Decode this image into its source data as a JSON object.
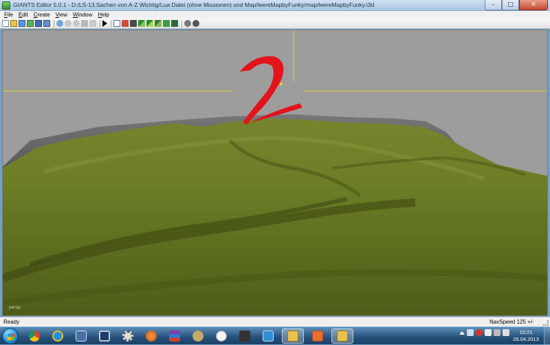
{
  "window": {
    "title": "GIANTS Editor 5.0.1 - D:/LS-13.Sachen von A-Z Wichtig/Lua Datei (ohne Missionen) und Map/leereMapbyFunky/map/leereMapbyFunky.i3d",
    "min_glyph": "–",
    "max_glyph": "□",
    "close_glyph": "✕"
  },
  "menu": {
    "file": "File",
    "edit": "Edit",
    "create": "Create",
    "view": "View",
    "window": "Window",
    "help": "Help"
  },
  "viewport": {
    "camera_label": "persp",
    "overlay_number": "2",
    "overlay_color": "#e3131c",
    "gizmo_color": "#e8d02a",
    "sky_color": "#9d9d9d",
    "terrain_color": "#6b7d26"
  },
  "status": {
    "left": "Ready",
    "right": "NavSpeed 125 +/-"
  },
  "taskbar": {
    "clock_time": "10:21",
    "clock_date": "29.04.2013"
  }
}
